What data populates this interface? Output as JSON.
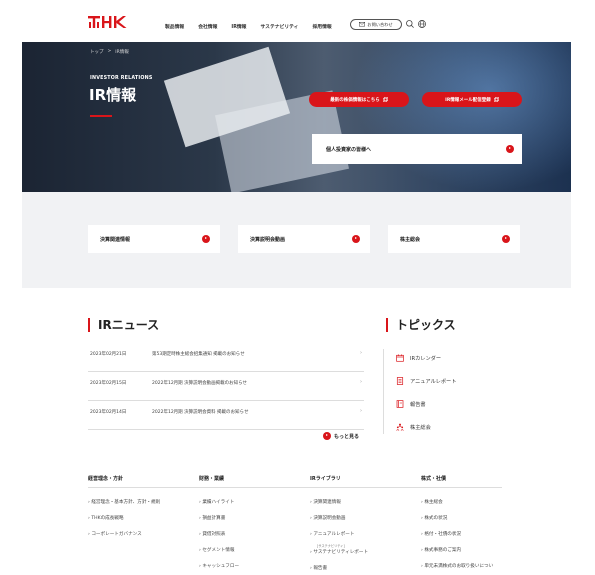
{
  "header": {
    "logo": "THK",
    "nav": [
      "製品情報",
      "会社情報",
      "IR情報",
      "サステナビリティ",
      "採用情報"
    ],
    "contact_label": "お問い合わせ",
    "search_icon": "search-icon",
    "language_icon": "globe-icon"
  },
  "hero": {
    "breadcrumb": [
      "トップ",
      ">",
      "IR情報"
    ],
    "eyebrow": "INVESTOR RELATIONS",
    "title": "IR情報",
    "button_stock": "最新の株価情報はこちら",
    "button_mail": "IR情報メール配信登録",
    "investor_card": "個人投資家の皆様へ"
  },
  "cards": [
    "決算関連情報",
    "決算説明会動画",
    "株主総会"
  ],
  "news": {
    "title": "IRニュース",
    "items": [
      {
        "date": "2023年02月21日",
        "title": "第53期定時株主総会招集通知 掲載のお知らせ"
      },
      {
        "date": "2023年02月15日",
        "title": "2022年12月期 決算説明会動画掲載のお知らせ"
      },
      {
        "date": "2023年02月14日",
        "title": "2022年12月期 決算説明会資料 掲載のお知らせ"
      }
    ],
    "more": "もっと見る"
  },
  "topics": {
    "title": "トピックス",
    "items": [
      {
        "label": "IRカレンダー",
        "icon": "calendar-icon"
      },
      {
        "label": "アニュアルレポート",
        "icon": "document-icon"
      },
      {
        "label": "報告書",
        "icon": "book-icon"
      },
      {
        "label": "株主総会",
        "icon": "people-icon"
      }
    ]
  },
  "footer": {
    "columns": [
      {
        "heading": "経営理念・方針",
        "items": [
          "経営理念・基本方針、方針・規則",
          "THKの成長戦略",
          "コーポレートガバナンス"
        ]
      },
      {
        "heading": "財務・業績",
        "items": [
          "業績ハイライト",
          "損益計算書",
          "貸借対照表",
          "セグメント情報",
          "キャッシュフロー"
        ]
      },
      {
        "heading": "IRライブラリ",
        "items": [
          "決算関連情報",
          "決算説明会動画",
          "アニュアルレポート",
          "サステナビリティレポート",
          "報告書"
        ],
        "small": "[サステナビリティ]"
      },
      {
        "heading": "株式・社債",
        "items": [
          "株主総会",
          "株式の状況",
          "格付・社債の状況",
          "株式事務のご案内",
          "単元未満株式のお取り扱いについ"
        ]
      }
    ]
  },
  "colors": {
    "accent": "#d9151a"
  }
}
